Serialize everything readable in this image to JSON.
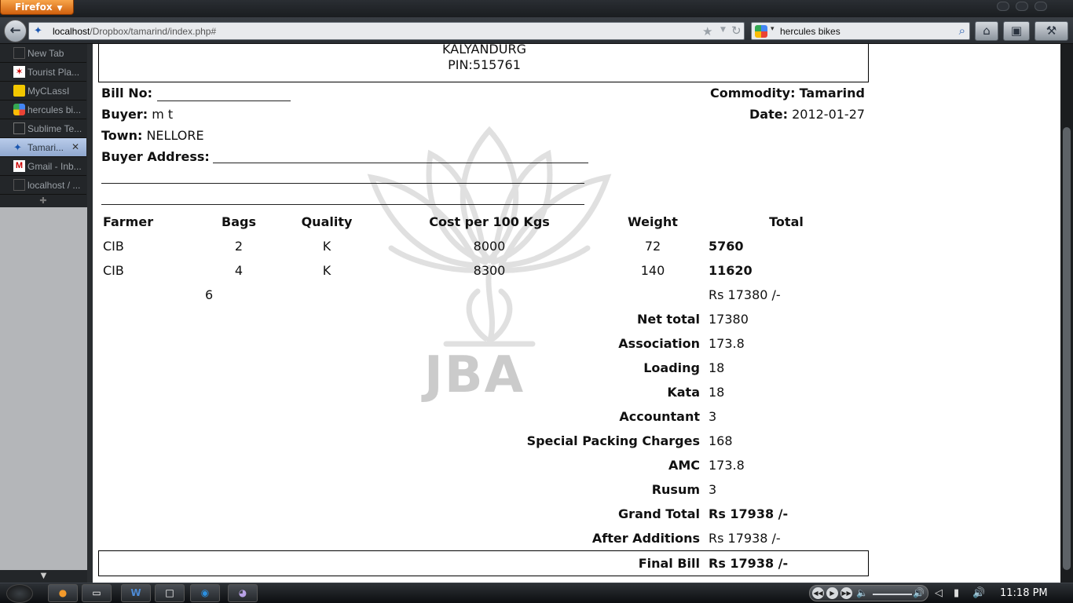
{
  "browser": {
    "menu_label": "Firefox",
    "url_host": "localhost",
    "url_path": "/Dropbox/tamarind/index.php#",
    "search_text": "hercules bikes"
  },
  "tabs": [
    {
      "label": "New Tab",
      "icon": "blank-page-icon"
    },
    {
      "label": "Tourist Pla...",
      "icon": "tourist-site-icon"
    },
    {
      "label": "MyCLassI",
      "icon": "myclassi-icon"
    },
    {
      "label": "hercules bi...",
      "icon": "google-icon"
    },
    {
      "label": "Sublime Te...",
      "icon": "blank-page-icon"
    },
    {
      "label": "Tamari...",
      "icon": "maple-leaf-icon",
      "active": true
    },
    {
      "label": "Gmail - Inb...",
      "icon": "gmail-icon"
    },
    {
      "label": "localhost / ...",
      "icon": "blank-page-icon"
    }
  ],
  "bill": {
    "header_line1": "KALYANDURG",
    "header_line2": "PIN:515761",
    "bill_no_label": "Bill No:",
    "commodity_label": "Commodity:",
    "commodity_value": "Tamarind",
    "buyer_label": "Buyer:",
    "buyer_value": "m t",
    "date_label": "Date:",
    "date_value": "2012-01-27",
    "town_label": "Town:",
    "town_value": "NELLORE",
    "buyer_address_label": "Buyer Address:",
    "watermark_text": "JBA"
  },
  "table": {
    "headers": {
      "farmer": "Farmer",
      "bags": "Bags",
      "quality": "Quality",
      "cost": "Cost per 100 Kgs",
      "weight": "Weight",
      "total": "Total"
    },
    "rows": [
      {
        "farmer": "CIB",
        "bags": "2",
        "quality": "K",
        "cost": "8000",
        "weight": "72",
        "total": "5760"
      },
      {
        "farmer": "CIB",
        "bags": "4",
        "quality": "K",
        "cost": "8300",
        "weight": "140",
        "total": "11620"
      }
    ],
    "bags_sum": "6",
    "total_sum": "Rs 17380 /-"
  },
  "charges": [
    {
      "label": "Net total",
      "value": "17380",
      "bold_value": false
    },
    {
      "label": "Association",
      "value": "173.8",
      "bold_value": false
    },
    {
      "label": "Loading",
      "value": "18",
      "bold_value": false
    },
    {
      "label": "Kata",
      "value": "18",
      "bold_value": false
    },
    {
      "label": "Accountant",
      "value": "3",
      "bold_value": false
    },
    {
      "label": "Special Packing Charges",
      "value": "168",
      "bold_value": false
    },
    {
      "label": "AMC",
      "value": "173.8",
      "bold_value": false
    },
    {
      "label": "Rusum",
      "value": "3",
      "bold_value": false
    },
    {
      "label": "Grand Total",
      "value": "Rs 17938 /-",
      "bold_value": true
    },
    {
      "label": "After Additions",
      "value": "Rs 17938 /-",
      "bold_value": false
    }
  ],
  "final": {
    "label": "Final Bill",
    "value": "Rs 17938 /-"
  },
  "taskbar": {
    "clock": "11:18 PM"
  }
}
